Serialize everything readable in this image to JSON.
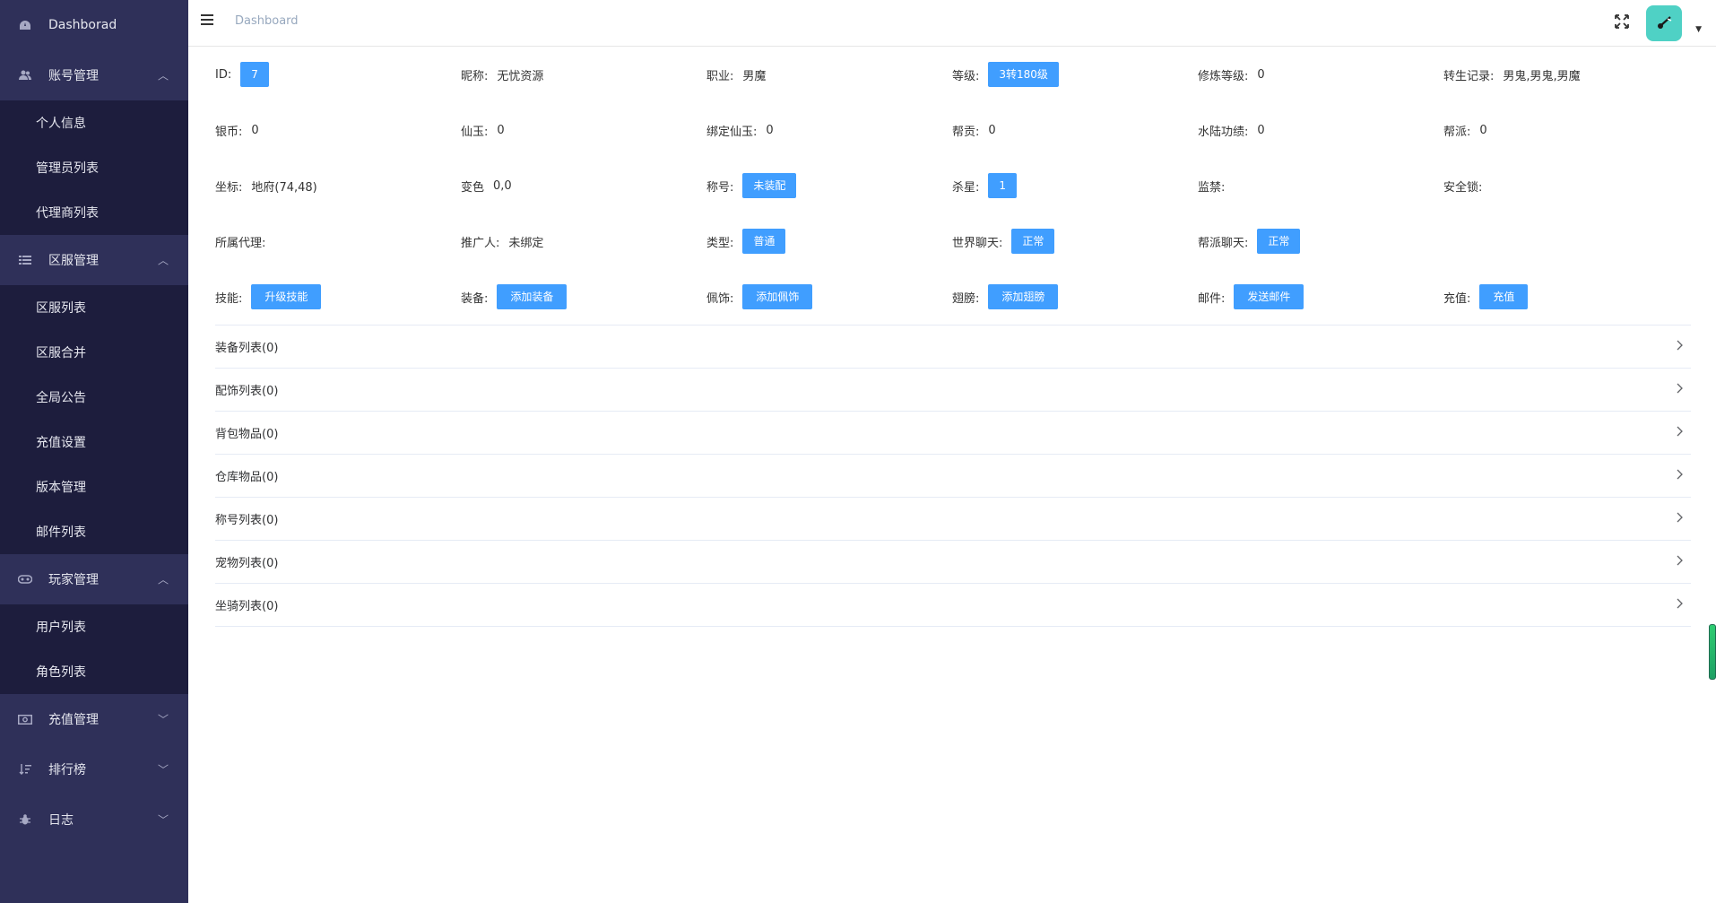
{
  "sidebar": {
    "dashboard": "Dashborad",
    "groups": [
      {
        "title": "账号管理",
        "icon": "users-icon",
        "expanded": true,
        "items": [
          "个人信息",
          "管理员列表",
          "代理商列表"
        ]
      },
      {
        "title": "区服管理",
        "icon": "list-icon",
        "expanded": true,
        "items": [
          "区服列表",
          "区服合并",
          "全局公告",
          "充值设置",
          "版本管理",
          "邮件列表"
        ]
      },
      {
        "title": "玩家管理",
        "icon": "gamepad-icon",
        "expanded": true,
        "items": [
          "用户列表",
          "角色列表"
        ]
      },
      {
        "title": "充值管理",
        "icon": "money-icon",
        "expanded": false,
        "items": []
      },
      {
        "title": "排行榜",
        "icon": "sort-icon",
        "expanded": false,
        "items": []
      },
      {
        "title": "日志",
        "icon": "bug-icon",
        "expanded": false,
        "items": []
      }
    ]
  },
  "header": {
    "breadcrumb": "Dashboard"
  },
  "info": {
    "row1": {
      "id_label": "ID:",
      "id_value": "7",
      "nickname_label": "昵称:",
      "nickname_value": "无忧资源",
      "job_label": "职业:",
      "job_value": "男魔",
      "level_label": "等级:",
      "level_value": "3转180级",
      "cultivate_label": "修炼等级:",
      "cultivate_value": "0",
      "rebirth_label": "转生记录:",
      "rebirth_value": "男鬼,男鬼,男魔"
    },
    "row2": {
      "silver_label": "银币:",
      "silver_value": "0",
      "jade_label": "仙玉:",
      "jade_value": "0",
      "bound_jade_label": "绑定仙玉:",
      "bound_jade_value": "0",
      "contrib_label": "帮贡:",
      "contrib_value": "0",
      "merit_label": "水陆功绩:",
      "merit_value": "0",
      "guild_label": "帮派:",
      "guild_value": "0"
    },
    "row3": {
      "coord_label": "坐标:",
      "coord_value": "地府(74,48)",
      "color_label": "变色",
      "color_value": "0,0",
      "title_label": "称号:",
      "title_value": "未装配",
      "kill_label": "杀星:",
      "kill_value": "1",
      "ban_label": "监禁:",
      "ban_value": "",
      "lock_label": "安全锁:",
      "lock_value": ""
    },
    "row4": {
      "agent_label": "所属代理:",
      "agent_value": "",
      "referrer_label": "推广人:",
      "referrer_value": "未绑定",
      "type_label": "类型:",
      "type_value": "普通",
      "world_chat_label": "世界聊天:",
      "world_chat_value": "正常",
      "guild_chat_label": "帮派聊天:",
      "guild_chat_value": "正常"
    },
    "row5": {
      "skill_label": "技能:",
      "skill_btn": "升级技能",
      "equip_label": "装备:",
      "equip_btn": "添加装备",
      "accessory_label": "佩饰:",
      "accessory_btn": "添加佩饰",
      "wing_label": "翅膀:",
      "wing_btn": "添加翅膀",
      "mail_label": "邮件:",
      "mail_btn": "发送邮件",
      "recharge_label": "充值:",
      "recharge_btn": "充值"
    }
  },
  "collapse": [
    "装备列表(0)",
    "配饰列表(0)",
    "背包物品(0)",
    "仓库物品(0)",
    "称号列表(0)",
    "宠物列表(0)",
    "坐骑列表(0)"
  ],
  "colors": {
    "sidebar_bg": "#2f3059",
    "submenu_bg": "#1d1d3d",
    "primary": "#409eff",
    "avatar_bg": "#4fd1c5"
  }
}
